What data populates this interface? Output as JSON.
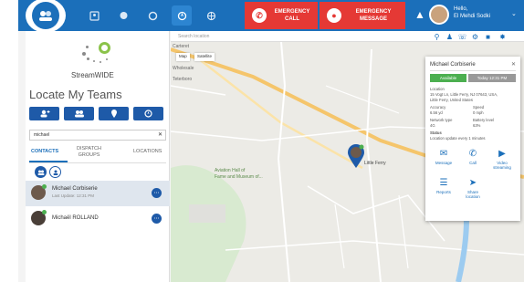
{
  "topbar": {
    "logo": "sw",
    "nav_icons": [
      "contacts-icon",
      "chat-icon",
      "alert-icon",
      "locate-icon",
      "grid-icon"
    ],
    "emergency_call": "EMERGENCY\nCALL",
    "emergency_call_l1": "EMERGENCY",
    "emergency_call_l2": "CALL",
    "emergency_msg_l1": "EMERGENCY",
    "emergency_msg_l2": "MESSAGE",
    "greeting": "Hello,",
    "user_name": "El Mehdi Sodki",
    "accent": "#1b6fba",
    "emergency_color": "#e53935"
  },
  "left": {
    "brand": "StreamWIDE",
    "title": "Locate My Teams",
    "search_value": "michael",
    "tabs": [
      {
        "label": "CONTACTS"
      },
      {
        "label_l1": "DISPATCH",
        "label_l2": "GROUPS"
      },
      {
        "label": "LOCATIONS"
      }
    ],
    "contacts": [
      {
        "name": "Michael Corbiserie",
        "sub": "Last Update: 12:31 PM",
        "selected": true
      },
      {
        "name": "Michaël ROLLAND",
        "sub": "",
        "selected": false
      }
    ]
  },
  "map": {
    "search_placeholder": "Search location",
    "map_type": [
      "Map",
      "Satellite"
    ],
    "labels": [
      "Carteret",
      "Wholesale",
      "Teterboro",
      "Aviation Hall of",
      "Fame and Museum of...",
      "Little Ferry"
    ],
    "popup": {
      "name": "Michael Corbiserie",
      "status": "Available",
      "time": "Today 12:31 PM",
      "location_label": "Location",
      "address_l1": "15 Vogt Ln, Little Ferry, NJ 07643, USA,",
      "address_l2": "Little Ferry, United States",
      "accuracy_label": "Accuracy",
      "accuracy_value": "6.56 yd",
      "speed_label": "Speed",
      "speed_value": "0 mph",
      "network_label": "Network type",
      "network_value": "4G",
      "battery_label": "Battery level",
      "battery_value": "63%",
      "status_label": "Status",
      "status_value": "Location update every 1 minutes",
      "actions": [
        {
          "label": "Message",
          "icon": "message-icon"
        },
        {
          "label": "Call",
          "icon": "phone-icon"
        },
        {
          "label_l1": "Video",
          "label_l2": "streaming",
          "icon": "video-icon"
        },
        {
          "label": "Reports",
          "icon": "reports-icon"
        },
        {
          "label_l1": "Share",
          "label_l2": "location",
          "icon": "share-location-icon"
        }
      ]
    }
  }
}
